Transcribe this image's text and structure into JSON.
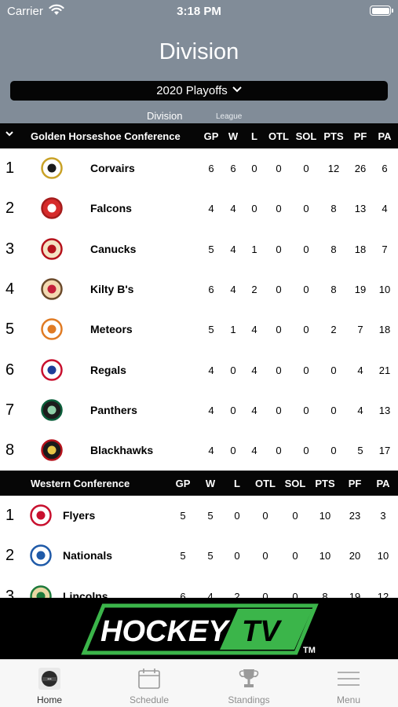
{
  "status_bar": {
    "carrier": "Carrier",
    "time": "3:18 PM"
  },
  "header": {
    "title": "Division",
    "season": "2020 Playoffs",
    "tabs": [
      {
        "label": "Division"
      },
      {
        "label": "League"
      }
    ]
  },
  "columns": [
    "GP",
    "W",
    "L",
    "OTL",
    "SOL",
    "PTS",
    "PF",
    "PA"
  ],
  "conferences": [
    {
      "name": "Golden Horseshoe Conference",
      "teams": [
        {
          "rank": "1",
          "name": "Corvairs",
          "stats": [
            "6",
            "6",
            "0",
            "0",
            "0",
            "12",
            "26",
            "6"
          ]
        },
        {
          "rank": "2",
          "name": "Falcons",
          "stats": [
            "4",
            "4",
            "0",
            "0",
            "0",
            "8",
            "13",
            "4"
          ]
        },
        {
          "rank": "3",
          "name": "Canucks",
          "stats": [
            "5",
            "4",
            "1",
            "0",
            "0",
            "8",
            "18",
            "7"
          ]
        },
        {
          "rank": "4",
          "name": "Kilty B's",
          "stats": [
            "6",
            "4",
            "2",
            "0",
            "0",
            "8",
            "19",
            "10"
          ]
        },
        {
          "rank": "5",
          "name": "Meteors",
          "stats": [
            "5",
            "1",
            "4",
            "0",
            "0",
            "2",
            "7",
            "18"
          ]
        },
        {
          "rank": "6",
          "name": "Regals",
          "stats": [
            "4",
            "0",
            "4",
            "0",
            "0",
            "0",
            "4",
            "21"
          ]
        },
        {
          "rank": "7",
          "name": "Panthers",
          "stats": [
            "4",
            "0",
            "4",
            "0",
            "0",
            "0",
            "4",
            "13"
          ]
        },
        {
          "rank": "8",
          "name": "Blackhawks",
          "stats": [
            "4",
            "0",
            "4",
            "0",
            "0",
            "0",
            "5",
            "17"
          ]
        }
      ]
    },
    {
      "name": "Western Conference",
      "teams": [
        {
          "rank": "1",
          "name": "Flyers",
          "stats": [
            "5",
            "5",
            "0",
            "0",
            "0",
            "10",
            "23",
            "3"
          ]
        },
        {
          "rank": "2",
          "name": "Nationals",
          "stats": [
            "5",
            "5",
            "0",
            "0",
            "0",
            "10",
            "20",
            "10"
          ]
        },
        {
          "rank": "3",
          "name": "Lincolns",
          "stats": [
            "6",
            "4",
            "2",
            "0",
            "0",
            "8",
            "19",
            "12"
          ]
        }
      ]
    }
  ],
  "banner": {
    "text_left": "HOCKEY",
    "text_right": "TV",
    "trademark": "TM"
  },
  "tabbar": [
    {
      "label": "Home",
      "icon": "home-logo-icon"
    },
    {
      "label": "Schedule",
      "icon": "calendar-icon"
    },
    {
      "label": "Standings",
      "icon": "trophy-icon"
    },
    {
      "label": "Menu",
      "icon": "menu-icon"
    }
  ],
  "colors": {
    "header_bg": "#818c98",
    "accent_green": "#3bb54a",
    "table_header_bg": "#060606"
  }
}
